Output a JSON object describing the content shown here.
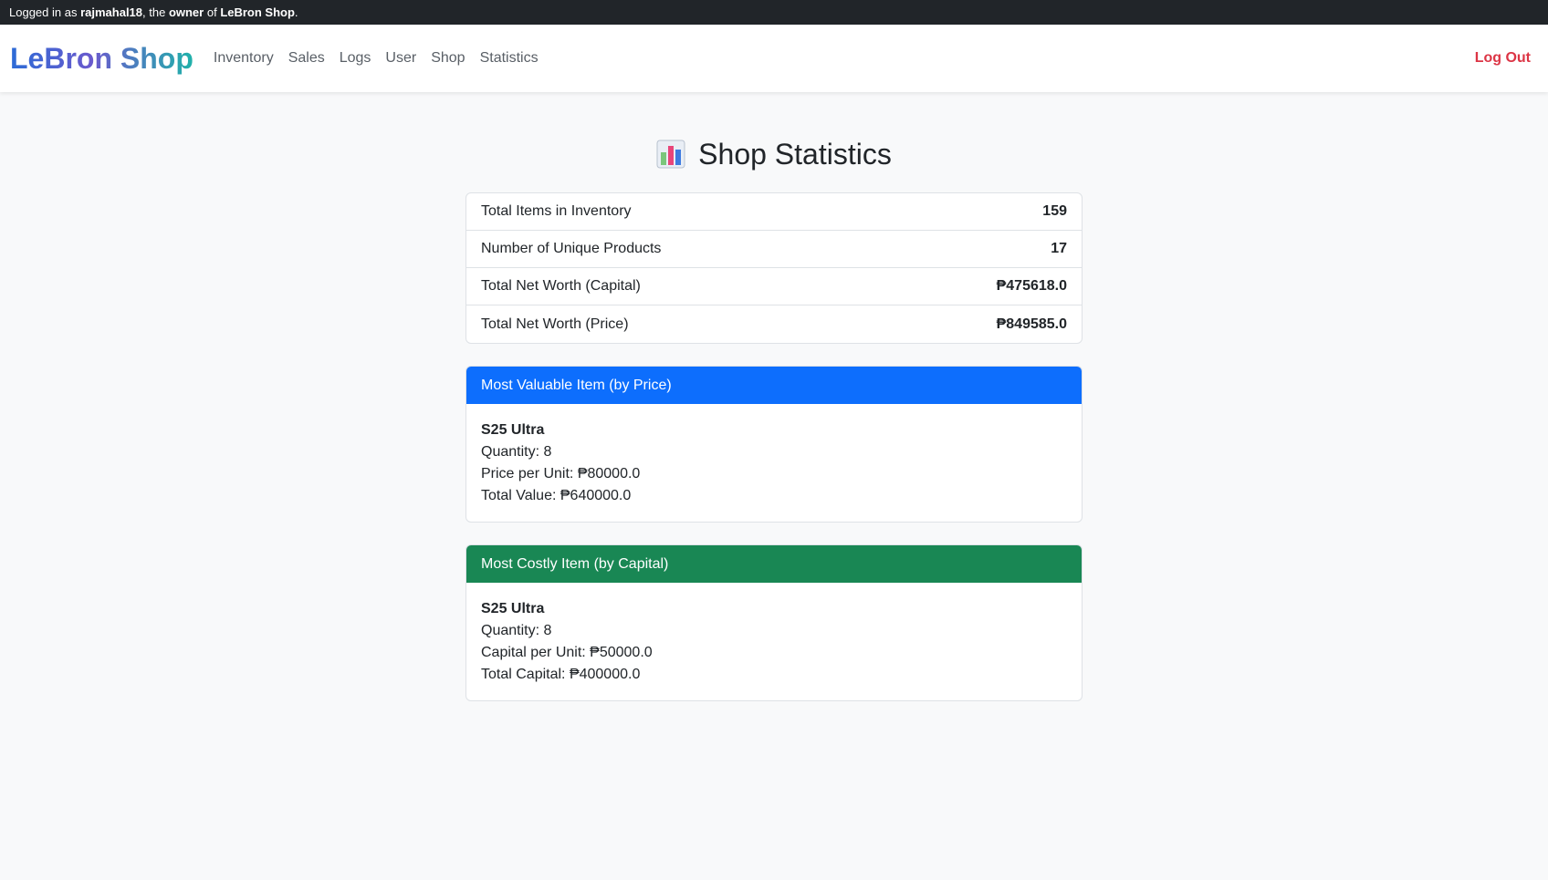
{
  "topbar": {
    "prefix": "Logged in as ",
    "username": "rajmahal18",
    "middle": ", the ",
    "role": "owner",
    "of": " of ",
    "shop": "LeBron Shop",
    "suffix": "."
  },
  "navbar": {
    "brand": "LeBron Shop",
    "links": [
      "Inventory",
      "Sales",
      "Logs",
      "User",
      "Shop",
      "Statistics"
    ],
    "logout": "Log Out"
  },
  "page": {
    "title": "Shop Statistics",
    "icon": "bar-chart-icon"
  },
  "stats": [
    {
      "label": "Total Items in Inventory",
      "value": "159"
    },
    {
      "label": "Number of Unique Products",
      "value": "17"
    },
    {
      "label": "Total Net Worth (Capital)",
      "value": "₱475618.0"
    },
    {
      "label": "Total Net Worth (Price)",
      "value": "₱849585.0"
    }
  ],
  "most_valuable": {
    "header": "Most Valuable Item (by Price)",
    "name": "S25 Ultra",
    "line1": "Quantity: 8",
    "line2": "Price per Unit: ₱80000.0",
    "line3": "Total Value: ₱640000.0"
  },
  "most_costly": {
    "header": "Most Costly Item (by Capital)",
    "name": "S25 Ultra",
    "line1": "Quantity: 8",
    "line2": "Capital per Unit: ₱50000.0",
    "line3": "Total Capital: ₱400000.0"
  },
  "colors": {
    "topbar": "#212529",
    "primary": "#0d6efd",
    "success": "#198754",
    "danger": "#dc3545",
    "background": "#f8f9fa"
  }
}
